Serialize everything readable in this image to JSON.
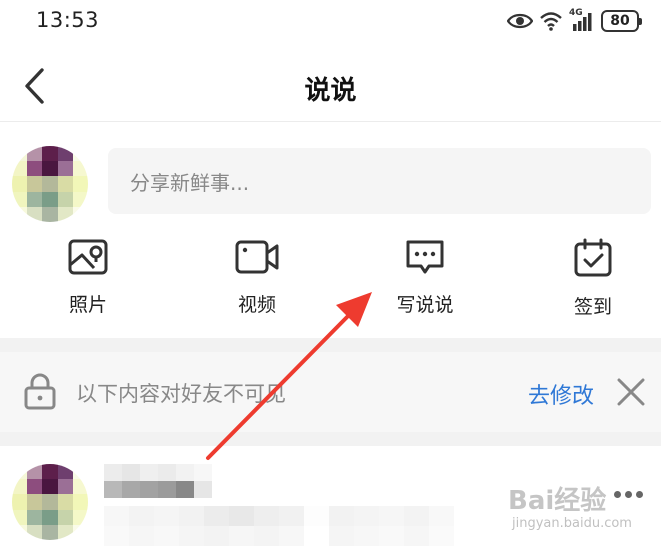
{
  "status_bar": {
    "time": "13:53",
    "network": "4G",
    "battery": "80"
  },
  "nav": {
    "title": "说说",
    "back_icon": "chevron-left-icon"
  },
  "composer": {
    "placeholder": "分享新鲜事...",
    "actions": [
      {
        "label": "照片",
        "icon": "photo-icon"
      },
      {
        "label": "视频",
        "icon": "video-camera-icon"
      },
      {
        "label": "写说说",
        "icon": "message-icon"
      },
      {
        "label": "签到",
        "icon": "calendar-check-icon"
      }
    ]
  },
  "notice": {
    "text": "以下内容对好友不可见",
    "link": "去修改",
    "lock_icon": "lock-icon",
    "close_icon": "close-icon"
  },
  "watermark": {
    "logo": "Bai经验",
    "url": "jingyan.baidu.com"
  },
  "colors": {
    "link": "#2f78d6",
    "annotation_arrow": "#ee3b2f",
    "input_background": "#f5f5f5",
    "section_gap": "#f2f2f2"
  }
}
